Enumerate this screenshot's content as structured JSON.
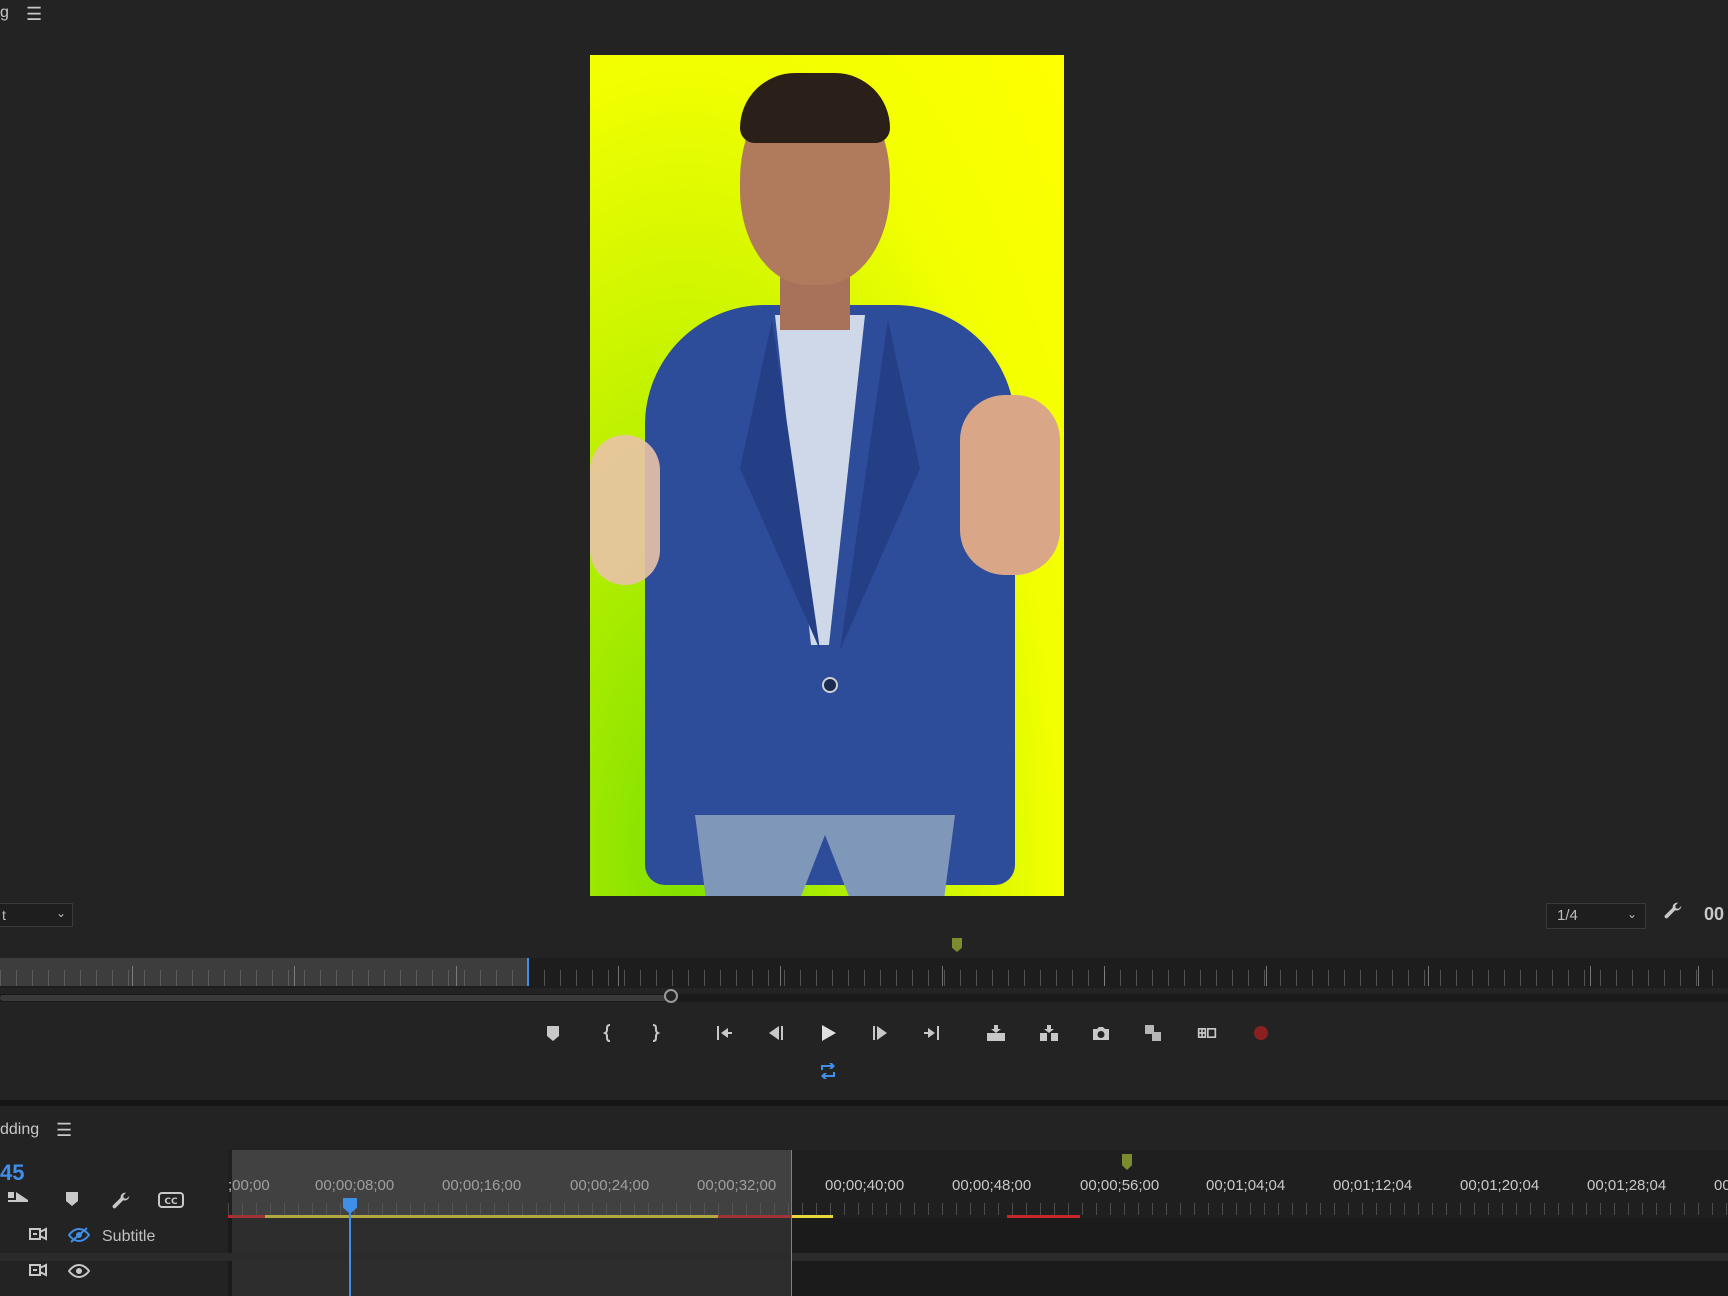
{
  "program_monitor": {
    "tab_title": "g",
    "fit_label": "t",
    "resolution_label": "1/4",
    "timecode_right": "00"
  },
  "timeline": {
    "title": "dding",
    "current_timecode": "45",
    "ruler_labels": [
      ";00;00",
      "00;00;08;00",
      "00;00;16;00",
      "00;00;24;00",
      "00;00;32;00",
      "00;00;40;00",
      "00;00;48;00",
      "00;00;56;00",
      "00;01;04;04",
      "00;01;12;04",
      "00;01;20;04",
      "00;01;28;04",
      "00"
    ],
    "tracks": [
      {
        "name": "Subtitle"
      },
      {
        "name": ""
      }
    ]
  },
  "icons": {
    "menu": "hamburger-icon",
    "wrench": "wrench-icon",
    "record": "record-icon",
    "loop": "loop-icon"
  },
  "colors": {
    "accent": "#3f8ee8",
    "marker": "#7a8c2e",
    "render_yellow": "#e6d83a",
    "render_red": "#c8262a",
    "record": "#8b2020"
  }
}
